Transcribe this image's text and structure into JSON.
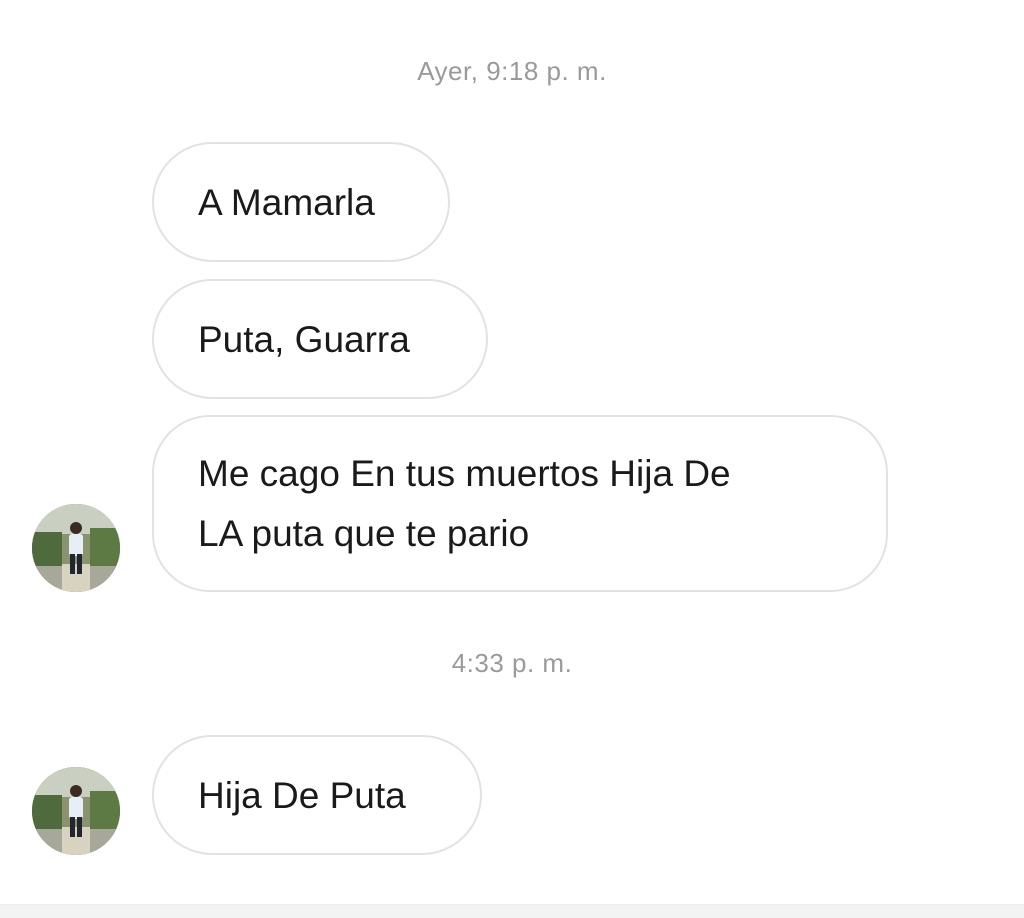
{
  "conversation": {
    "timestamps": [
      "Ayer, 9:18 p. m.",
      "4:33 p. m."
    ],
    "messages": [
      {
        "text": "A Mamarla"
      },
      {
        "text": "Puta, Guarra"
      },
      {
        "lines": [
          "Me cago En tus muertos Hija De",
          "LA puta que te pario"
        ]
      },
      {
        "text": "Hija De Puta"
      }
    ]
  },
  "icons": {
    "avatar": "user-avatar-icon"
  },
  "colors": {
    "timestamp": "#9a9a9a",
    "bubble_border": "#e2e2e2",
    "text": "#1a1a1a",
    "background": "#ffffff"
  }
}
